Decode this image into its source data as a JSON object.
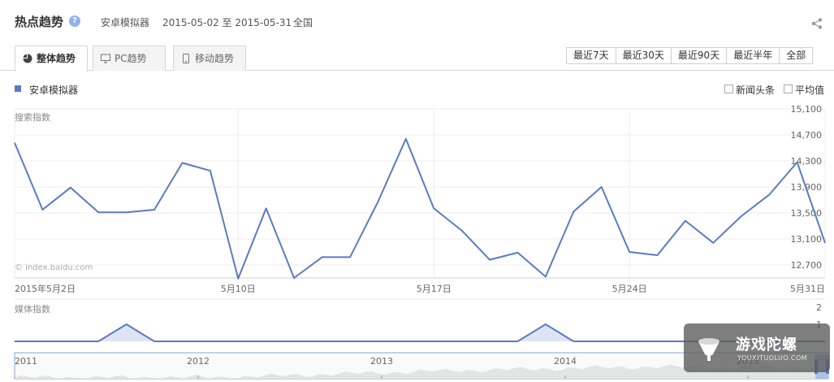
{
  "header": {
    "title": "热点趋势",
    "keyword": "安卓模拟器",
    "date_range": "2015-05-02 至 2015-05-31",
    "region": "全国"
  },
  "tabs": [
    {
      "label": "整体趋势",
      "active": true
    },
    {
      "label": "PC趋势",
      "active": false
    },
    {
      "label": "移动趋势",
      "active": false
    }
  ],
  "range_buttons": [
    "最近7天",
    "最近30天",
    "最近90天",
    "最近半年",
    "全部"
  ],
  "legend": {
    "series_label": "安卓模拟器",
    "color": "#5b7bc0"
  },
  "options": {
    "news": "新闻头条",
    "average": "平均值"
  },
  "watermark": "© index.baidu.com",
  "brand": {
    "name": "游戏陀螺",
    "url": "YOUXITUOLUO.COM"
  },
  "chart_data": [
    {
      "type": "line",
      "title": "搜索指数",
      "x": [
        "2015-05-02",
        "2015-05-03",
        "2015-05-04",
        "2015-05-05",
        "2015-05-06",
        "2015-05-07",
        "2015-05-08",
        "2015-05-09",
        "2015-05-10",
        "2015-05-11",
        "2015-05-12",
        "2015-05-13",
        "2015-05-14",
        "2015-05-15",
        "2015-05-16",
        "2015-05-17",
        "2015-05-18",
        "2015-05-19",
        "2015-05-20",
        "2015-05-21",
        "2015-05-22",
        "2015-05-23",
        "2015-05-24",
        "2015-05-25",
        "2015-05-26",
        "2015-05-27",
        "2015-05-28",
        "2015-05-29",
        "2015-05-30",
        "2015-05-31"
      ],
      "x_tick_labels": [
        "2015年5月2日",
        "5月10日",
        "5月17日",
        "5月24日",
        "5月31日"
      ],
      "series": [
        {
          "values": [
            14580,
            13550,
            13890,
            13510,
            13510,
            13550,
            14270,
            14150,
            12490,
            13570,
            12500,
            12820,
            12820,
            13670,
            14640,
            13570,
            13230,
            12780,
            12890,
            12520,
            13520,
            13900,
            12900,
            12850,
            13380,
            13040,
            13450,
            13780,
            14280,
            13040
          ]
        }
      ],
      "y_ticks": [
        15100,
        14700,
        14300,
        13900,
        13500,
        13100,
        12700
      ],
      "y_tick_labels": [
        "15,100",
        "14,700",
        "14,300",
        "13,900",
        "13,500",
        "13,100",
        "12,700"
      ],
      "ylim": [
        12500,
        15100
      ],
      "grid": true
    },
    {
      "type": "area",
      "title": "媒体指数",
      "series": [
        {
          "values": [
            0,
            0,
            0,
            0,
            1,
            0,
            0,
            0,
            0,
            0,
            0,
            0,
            0,
            0,
            0,
            0,
            0,
            0,
            0,
            1,
            0,
            0,
            0,
            0,
            0,
            0,
            0,
            0,
            0,
            0
          ]
        }
      ],
      "y_ticks": [
        2,
        1
      ],
      "ylim": [
        0,
        2
      ]
    },
    {
      "type": "area",
      "x_tick_labels": [
        "2011",
        "2012",
        "2013",
        "2014",
        "2015"
      ]
    }
  ]
}
